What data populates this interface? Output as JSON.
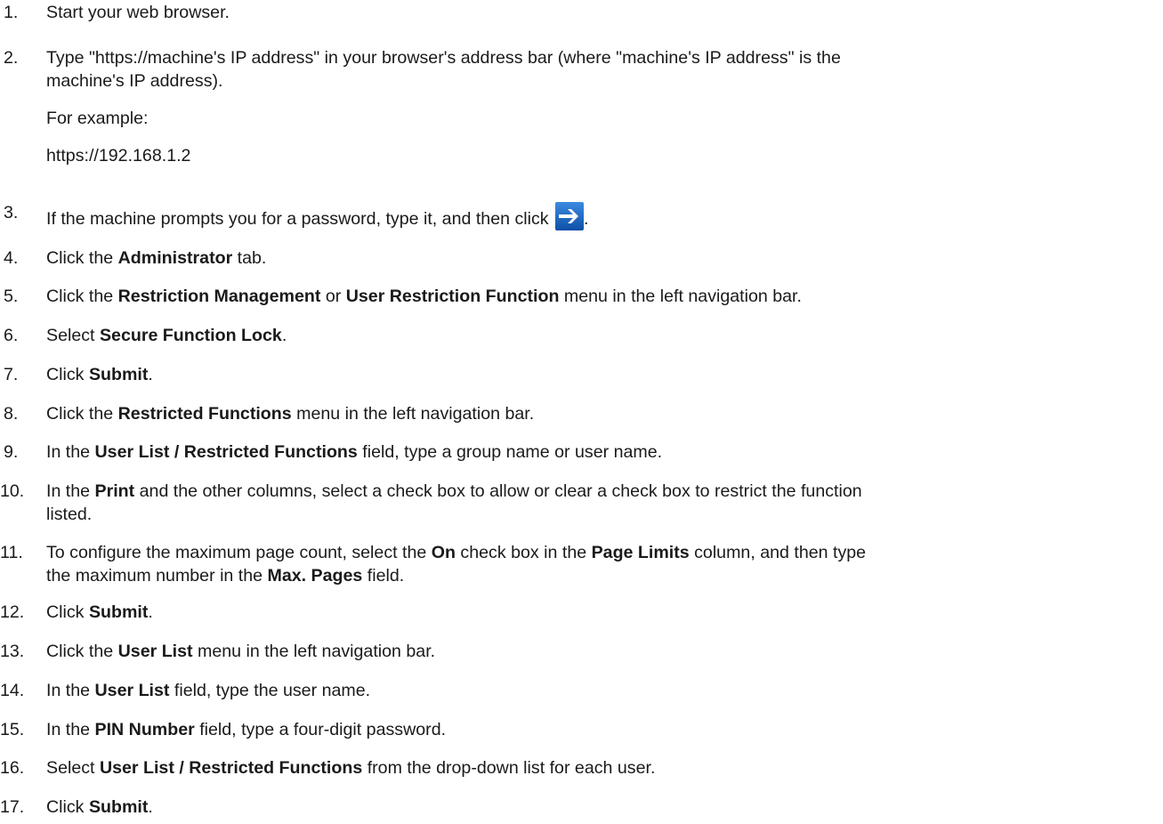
{
  "steps": [
    {
      "number": "1.",
      "text": "Start your web browser."
    },
    {
      "number": "2.",
      "line1": "Type \"https://machine's IP address\" in your browser's address bar (where \"machine's IP address\" is the",
      "line2": "machine's IP address).",
      "example_label": "For example:",
      "example_value": "https://192.168.1.2"
    },
    {
      "number": "3.",
      "text": "If the machine prompts you for a password, type it, and then click",
      "after": "."
    },
    {
      "number": "4.",
      "pre": "Click the ",
      "bold1": "Administrator",
      "post": " tab."
    },
    {
      "number": "5.",
      "pre": "Click the ",
      "bold1": "Restriction Management",
      "mid": " or ",
      "bold2": "User Restriction Function",
      "post": " menu in the left navigation bar."
    },
    {
      "number": "6.",
      "pre": "Select ",
      "bold1": "Secure Function Lock",
      "post": "."
    },
    {
      "number": "7.",
      "pre": "Click ",
      "bold1": "Submit",
      "post": "."
    },
    {
      "number": "8.",
      "pre": "Click the ",
      "bold1": "Restricted Functions",
      "post": " menu in the left navigation bar."
    },
    {
      "number": "9.",
      "pre": "In the ",
      "bold1": "User List / Restricted Functions",
      "post": " field, type a group name or user name."
    },
    {
      "number": "10.",
      "pre": "In the ",
      "bold1": "Print",
      "post": " and the other columns, select a check box to allow or clear a check box to restrict the function",
      "line2": "listed."
    },
    {
      "number": "11.",
      "pre": "To configure the maximum page count, select the ",
      "bold1": "On",
      "mid": " check box in the ",
      "bold2": "Page Limits",
      "post": " column, and then type",
      "line2_pre": "the maximum number in the ",
      "line2_bold": "Max. Pages",
      "line2_post": " field."
    },
    {
      "number": "12.",
      "pre": "Click ",
      "bold1": "Submit",
      "post": "."
    },
    {
      "number": "13.",
      "pre": "Click the ",
      "bold1": "User List",
      "post": " menu in the left navigation bar."
    },
    {
      "number": "14.",
      "pre": "In the ",
      "bold1": "User List",
      "post": " field, type the user name."
    },
    {
      "number": "15.",
      "pre": "In the ",
      "bold1": "PIN Number",
      "post": " field, type a four-digit password."
    },
    {
      "number": "16.",
      "pre": "Select ",
      "bold1": "User List / Restricted Functions",
      "post": " from the drop-down list for each user."
    },
    {
      "number": "17.",
      "pre": "Click ",
      "bold1": "Submit",
      "post": "."
    }
  ],
  "icons": {
    "go_button": "go-arrow-icon"
  },
  "colors": {
    "text": "#1a1a1a",
    "icon_blue": "#1565c0",
    "icon_arrow": "#ffffff"
  }
}
